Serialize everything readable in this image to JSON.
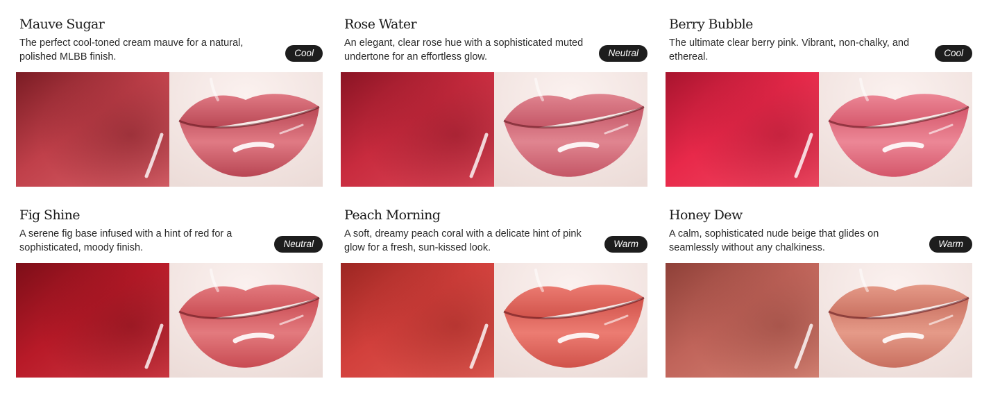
{
  "shades": [
    {
      "name": "Mauve Sugar",
      "description": "The perfect cool-toned cream mauve for a natural, polished MLBB finish.",
      "tone": "Cool",
      "colors": {
        "base": "#c0404a",
        "dark": "#7a1c24",
        "light": "#d9626a",
        "lip": "#e07a84",
        "lipDark": "#b84653"
      }
    },
    {
      "name": "Rose Water",
      "description": "An elegant, clear rose hue with a sophisticated muted undertone for an effortless glow.",
      "tone": "Neutral",
      "colors": {
        "base": "#c82b3e",
        "dark": "#8a1424",
        "light": "#dd4a5a",
        "lip": "#e08590",
        "lipDark": "#c45666"
      }
    },
    {
      "name": "Berry Bubble",
      "description": "The ultimate clear berry pink. Vibrant, non-chalky, and ethereal.",
      "tone": "Cool",
      "colors": {
        "base": "#e8294a",
        "dark": "#a8142e",
        "light": "#f04a63",
        "lip": "#ec8796",
        "lipDark": "#d4566a"
      }
    },
    {
      "name": "Fig Shine",
      "description": "A serene fig base infused with a hint of red for a sophisticated, moody finish.",
      "tone": "Neutral",
      "colors": {
        "base": "#b81a28",
        "dark": "#7d0e18",
        "light": "#d03a44",
        "lip": "#e37a7e",
        "lipDark": "#c84b52"
      }
    },
    {
      "name": "Peach Morning",
      "description": "A soft, dreamy peach coral with a delicate hint of pink glow for a fresh, sun-kissed look.",
      "tone": "Warm",
      "colors": {
        "base": "#d2403c",
        "dark": "#9c2622",
        "light": "#e05a52",
        "lip": "#ec7c72",
        "lipDark": "#d0524a"
      }
    },
    {
      "name": "Honey Dew",
      "description": "A calm, sophisticated nude beige that glides on seamlessly without any chalkiness.",
      "tone": "Warm",
      "colors": {
        "base": "#c0645a",
        "dark": "#8e4038",
        "light": "#d78576",
        "lip": "#e59a88",
        "lipDark": "#c86f5f"
      }
    }
  ]
}
